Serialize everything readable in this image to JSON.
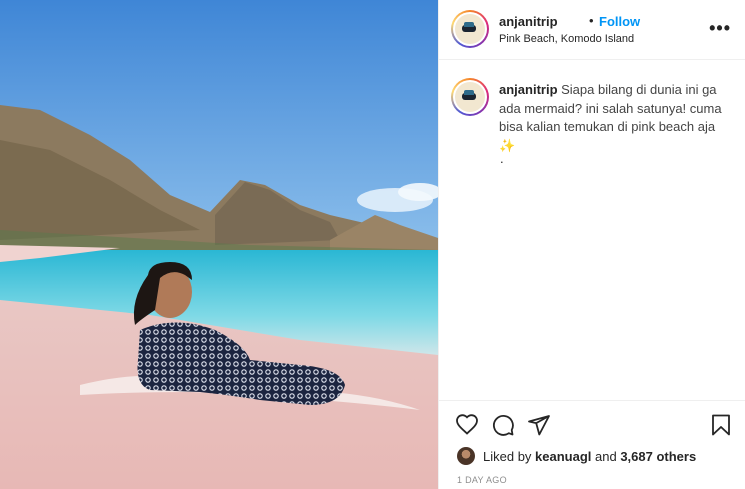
{
  "post": {
    "username": "anjanitrip",
    "follow_separator": "•",
    "follow_label": "Follow",
    "location": "Pink Beach, Komodo Island",
    "more_icon": "more-options-icon",
    "more_label": "•••"
  },
  "caption": {
    "username": "anjanitrip",
    "text": " Siapa bilang di dunia ini ga ada mermaid? ini salah satunya! cuma bisa kalian temukan di pink beach aja",
    "emoji": "✨",
    "trailing": "."
  },
  "actions": {
    "icons": [
      "heart-icon",
      "comment-icon",
      "share-icon",
      "bookmark-icon"
    ]
  },
  "likes": {
    "prefix": "Liked by ",
    "user": "keanuagl",
    "middle": " and ",
    "count": "3,687 others"
  },
  "timestamp": "1 DAY AGO",
  "colors": {
    "follow_blue": "#0095f6",
    "text": "#262626",
    "muted": "#8e8e8e",
    "border": "#efefef"
  }
}
